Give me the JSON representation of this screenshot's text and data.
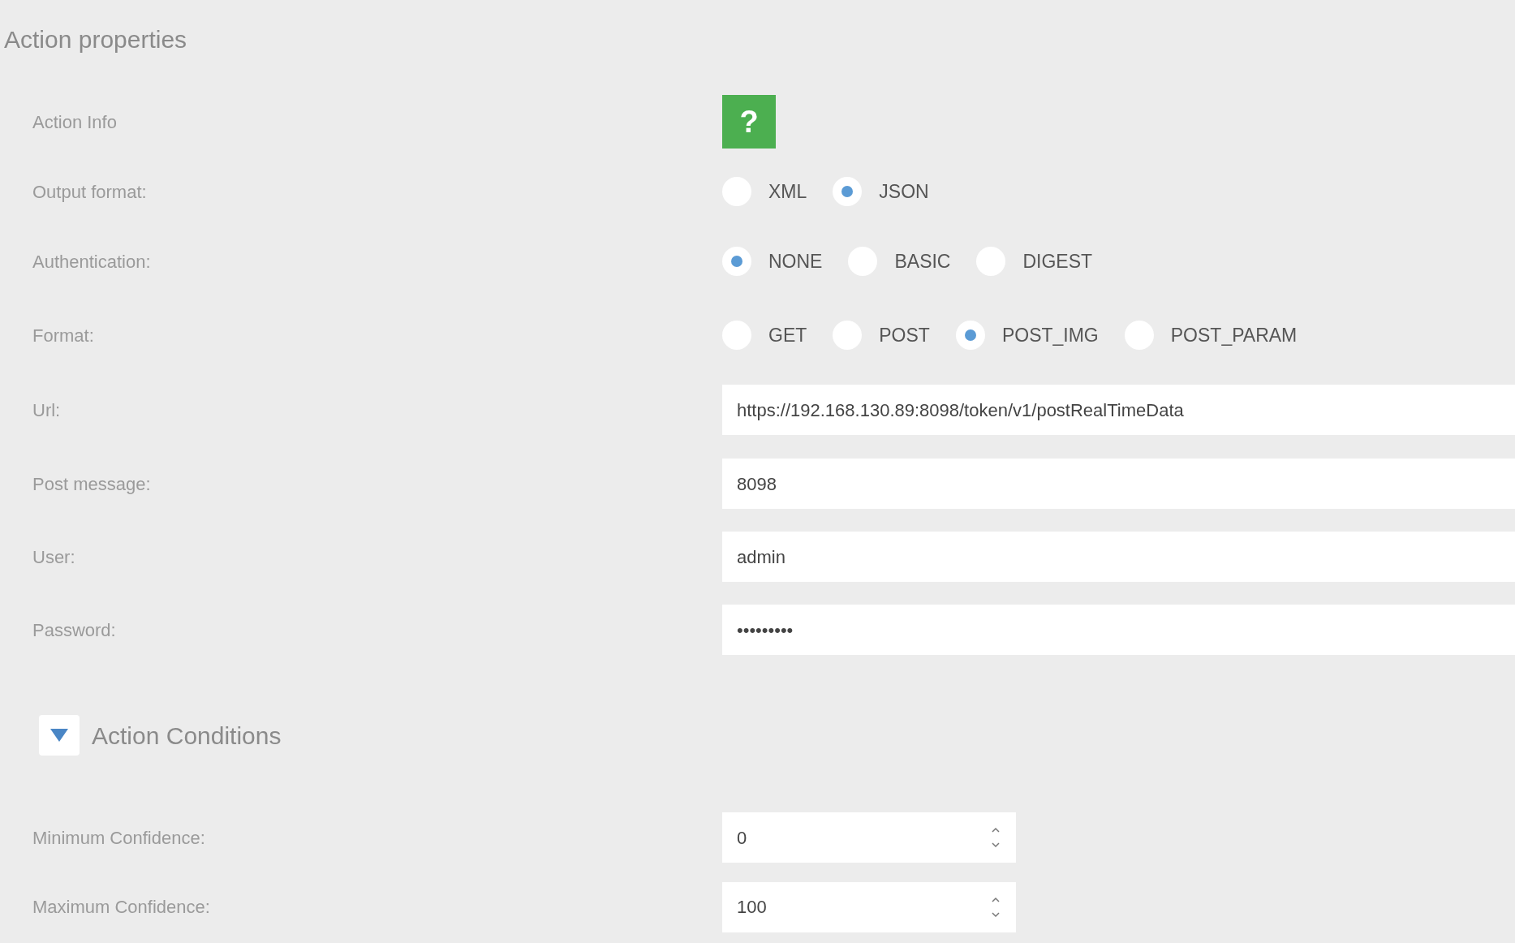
{
  "title": "Action properties",
  "fields": [
    {
      "kind": "info",
      "label": "Action Info",
      "button": "?"
    },
    {
      "kind": "radio",
      "label": "Output format:",
      "options": [
        {
          "label": "XML",
          "selected": false
        },
        {
          "label": "JSON",
          "selected": true
        }
      ]
    },
    {
      "kind": "radio",
      "label": "Authentication:",
      "options": [
        {
          "label": "NONE",
          "selected": true
        },
        {
          "label": "BASIC",
          "selected": false
        },
        {
          "label": "DIGEST",
          "selected": false
        }
      ]
    },
    {
      "kind": "radio",
      "label": "Format:",
      "options": [
        {
          "label": "GET",
          "selected": false
        },
        {
          "label": "POST",
          "selected": false
        },
        {
          "label": "POST_IMG",
          "selected": true
        },
        {
          "label": "POST_PARAM",
          "selected": false
        }
      ]
    },
    {
      "kind": "text",
      "label": "Url:",
      "value": "https://192.168.130.89:8098/token/v1/postRealTimeData"
    },
    {
      "kind": "text",
      "label": "Post message:",
      "value": "8098"
    },
    {
      "kind": "text",
      "label": "User:",
      "value": "admin"
    },
    {
      "kind": "password",
      "label": "Password:",
      "value": "•••••••••"
    }
  ],
  "section": {
    "title": "Action Conditions",
    "expanded": true
  },
  "conditions": [
    {
      "kind": "number",
      "label": "Minimum Confidence:",
      "value": "0"
    },
    {
      "kind": "number",
      "label": "Maximum Confidence:",
      "value": "100"
    }
  ]
}
